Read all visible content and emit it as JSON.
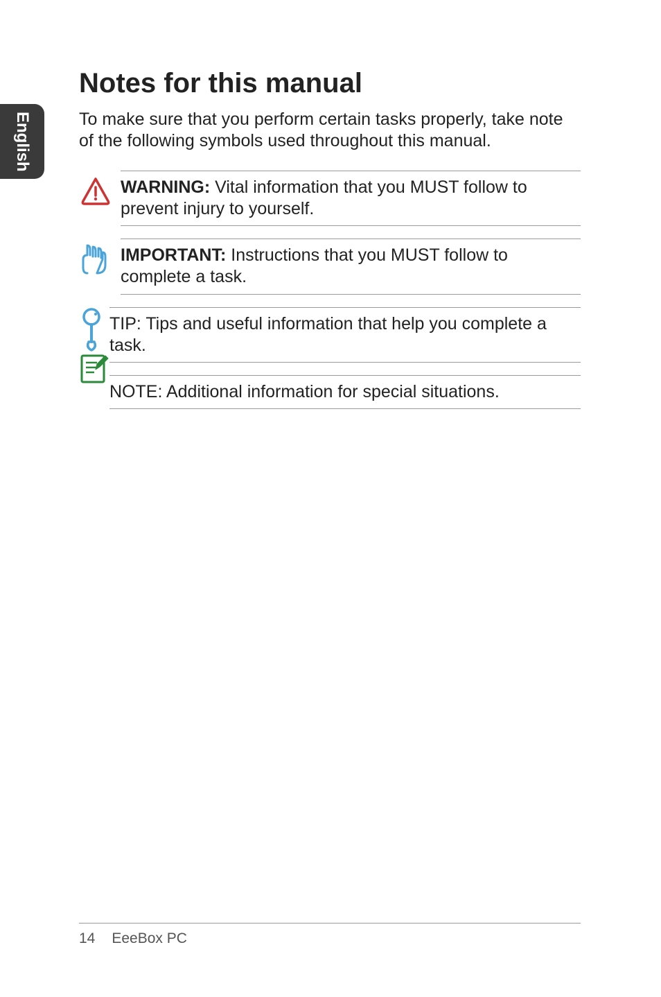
{
  "sideTab": {
    "label": "English"
  },
  "heading": "Notes for this manual",
  "intro": "To make sure that you perform certain tasks properly, take note of the following symbols used throughout this manual.",
  "notes": {
    "warning": {
      "label": "WARNING:",
      "text": " Vital information that you MUST follow to prevent injury to yourself."
    },
    "important": {
      "label": "IMPORTANT:",
      "text": " Instructions that you MUST follow to complete a task."
    },
    "tip": {
      "label": "TIP:",
      "text": " Tips and useful information that help you complete a task."
    },
    "note": {
      "label": "NOTE:",
      "text": " Additional information for special situations."
    }
  },
  "footer": {
    "page": "14",
    "title": "EeeBox PC"
  }
}
